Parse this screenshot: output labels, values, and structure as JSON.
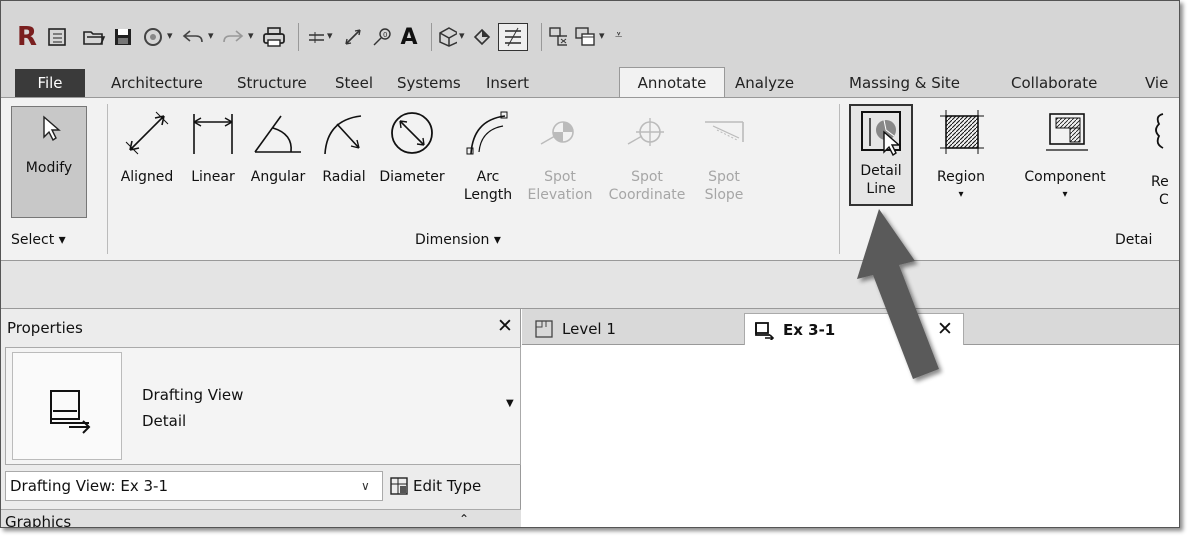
{
  "qat": {
    "app_logo": "R",
    "icons": [
      "revit-logo-icon",
      "open-recent-icon",
      "open-icon",
      "save-icon",
      "sync-icon",
      "undo-icon",
      "redo-icon",
      "print-icon",
      "measure-icon",
      "aligned-dimension-icon",
      "tag-icon",
      "text-icon",
      "3d-view-icon",
      "section-icon",
      "thin-lines-icon",
      "close-hidden-icon",
      "switch-windows-icon",
      "customize-icon"
    ]
  },
  "tabs": [
    {
      "label": "File"
    },
    {
      "label": "Architecture"
    },
    {
      "label": "Structure"
    },
    {
      "label": "Steel"
    },
    {
      "label": "Systems"
    },
    {
      "label": "Insert"
    },
    {
      "label": "Annotate"
    },
    {
      "label": "Analyze"
    },
    {
      "label": "Massing & Site"
    },
    {
      "label": "Collaborate"
    },
    {
      "label": "Vie"
    }
  ],
  "ribbon": {
    "select": {
      "modify_label": "Modify",
      "panel_label": "Select ▾"
    },
    "dimension": {
      "aligned": "Aligned",
      "linear": "Linear",
      "angular": "Angular",
      "radial": "Radial",
      "diameter": "Diameter",
      "arc_length_1": "Arc",
      "arc_length_2": "Length",
      "spot_elev_1": "Spot",
      "spot_elev_2": "Elevation",
      "spot_coord_1": "Spot",
      "spot_coord_2": "Coordinate",
      "spot_slope_1": "Spot",
      "spot_slope_2": "Slope",
      "panel_label": "Dimension ▾"
    },
    "detail": {
      "detail_line_1": "Detail",
      "detail_line_2": "Line",
      "region": "Region",
      "component": "Component",
      "revision_cloud_1": "Re",
      "revision_cloud_2": "C",
      "panel_label": "Detai"
    }
  },
  "properties": {
    "title": "Properties",
    "close": "✕",
    "type_line1": "Drafting View",
    "type_line2": "Detail",
    "instance_value": "Drafting View: Ex 3-1",
    "edit_type": "Edit Type",
    "section_graphics": "Graphics"
  },
  "views": {
    "level": "Level 1",
    "current": "Ex 3-1",
    "close": "✕"
  },
  "colors": {
    "qat_bg": "#d6d6d6",
    "ribbon_bg": "#f2f2f2",
    "file_tab": "#3a3a3a",
    "callout_arrow": "#555555"
  }
}
